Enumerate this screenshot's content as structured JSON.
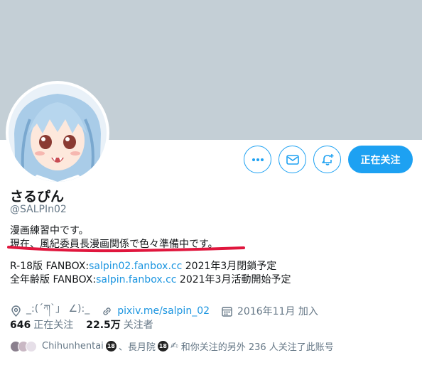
{
  "profile": {
    "display_name": "さるぴん",
    "handle": "@SALPIn02"
  },
  "actions": {
    "more_icon": "more-dots-icon",
    "message_icon": "mail-icon",
    "notify_icon": "bell-add-icon",
    "follow_label": "正在关注"
  },
  "bio": {
    "line1": "漫画練習中です。",
    "line2": "現在、風紀委員長漫画関係で色々準備中です。",
    "line3_prefix": "R-18版 FANBOX:",
    "line3_link": "salpin02.fanbox.cc",
    "line3_suffix": " 2021年3月閉鎖予定",
    "line4_prefix": "全年齢版 FANBOX:",
    "line4_link": "salpin.fanbox.cc",
    "line4_suffix": " 2021年3月活動開始予定"
  },
  "meta": {
    "location": "_:(´ཀ`」 ∠):_",
    "website": "pixiv.me/salpin_02",
    "joined": "2016年11月 加入"
  },
  "stats": {
    "following_count": "646",
    "following_label": "正在关注",
    "followers_count": "22.5万",
    "followers_label": "关注者"
  },
  "mutual": {
    "name1": "Chihunhentai",
    "badge": "18",
    "sep": "、長月院",
    "pen": "✍",
    "text": "和你关注的另外 236 人关注了此账号"
  },
  "colors": {
    "accent": "#1da1f2",
    "banner": "#c4cfd6",
    "marker": "#e0163d"
  }
}
